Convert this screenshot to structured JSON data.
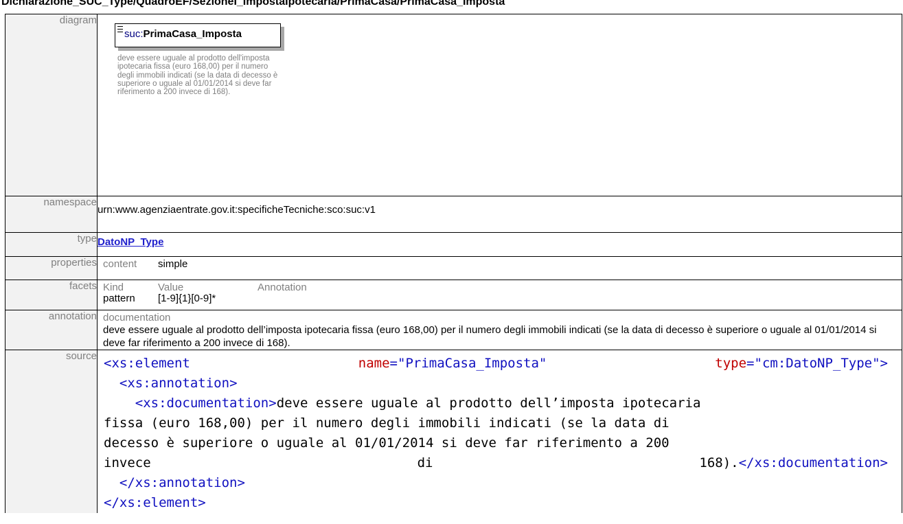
{
  "page_heading": "Dichiarazione_SUC_Type/QuadroEF/SezioneI_ImpostaIpotecaria/PrimaCasa/PrimaCasa_Imposta",
  "labels": {
    "diagram": "diagram",
    "namespace": "namespace",
    "type": "type",
    "properties": "properties",
    "facets": "facets",
    "annotation": "annotation",
    "source": "source"
  },
  "diagram": {
    "prefix": "suc:",
    "element_name": "PrimaCasa_Imposta",
    "caption": "deve essere uguale al prodotto dell'imposta ipotecaria fissa (euro 168,00) per il numero degli immobili indicati (se la data di decesso è superiore o uguale al 01/01/2014 si deve far riferimento a 200 invece di 168)."
  },
  "namespace_value": "urn:www.agenziaentrate.gov.it:specificheTecniche:sco:suc:v1",
  "type_value": "DatoNP_Type",
  "properties": {
    "header": "content",
    "value": "simple"
  },
  "facets": {
    "headers": [
      "Kind",
      "Value",
      "Annotation"
    ],
    "rows": [
      {
        "kind": "pattern",
        "value": "[1-9]{1}[0-9]*",
        "annotation": ""
      }
    ]
  },
  "annotation": {
    "header": "documentation",
    "text": "deve essere uguale al prodotto dell’imposta ipotecaria fissa (euro 168,00) per il numero degli immobili indicati (se la data di decesso è superiore o uguale al 01/01/2014 si deve far riferimento a 200 invece di 168)."
  },
  "source": {
    "open_tag": "xs:element",
    "name_attr": "name",
    "name_val": "\"PrimaCasa_Imposta\"",
    "type_attr": "type",
    "type_val": "\"cm:DatoNP_Type\"",
    "annotation_tag": "xs:annotation",
    "documentation_tag": "xs:documentation",
    "doc_line1": "deve essere uguale al prodotto dell’imposta ipotecaria",
    "doc_line2": "fissa (euro 168,00) per il numero degli immobili indicati (se la data di",
    "doc_line3": "decesso è superiore o uguale al 01/01/2014 si deve far riferimento a 200",
    "doc_line4_a": "invece",
    "doc_line4_b": "di",
    "doc_line4_c": "168)."
  }
}
